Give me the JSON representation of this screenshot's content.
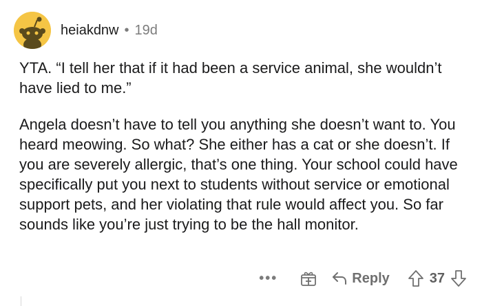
{
  "comment": {
    "username": "heiakdnw",
    "separator": "•",
    "age": "19d",
    "paragraphs": [
      "YTA. “I tell her that if it had been a service animal, she wouldn’t have lied to me.”",
      "Angela doesn’t have to tell you anything she doesn’t want to. You heard meowing. So what? She either has a cat or she doesn’t. If you are severely allergic, that’s one thing. Your school could have specifically put you next to students without service or emotional support pets, and her violating that rule would affect you. So far sounds like you’re just trying to be the hall monitor."
    ]
  },
  "actions": {
    "more_label": "•••",
    "reply_label": "Reply",
    "vote_count": "37"
  },
  "colors": {
    "avatar_bg": "#f5c545",
    "text": "#1a1a1b",
    "muted": "#7c7c7c"
  }
}
